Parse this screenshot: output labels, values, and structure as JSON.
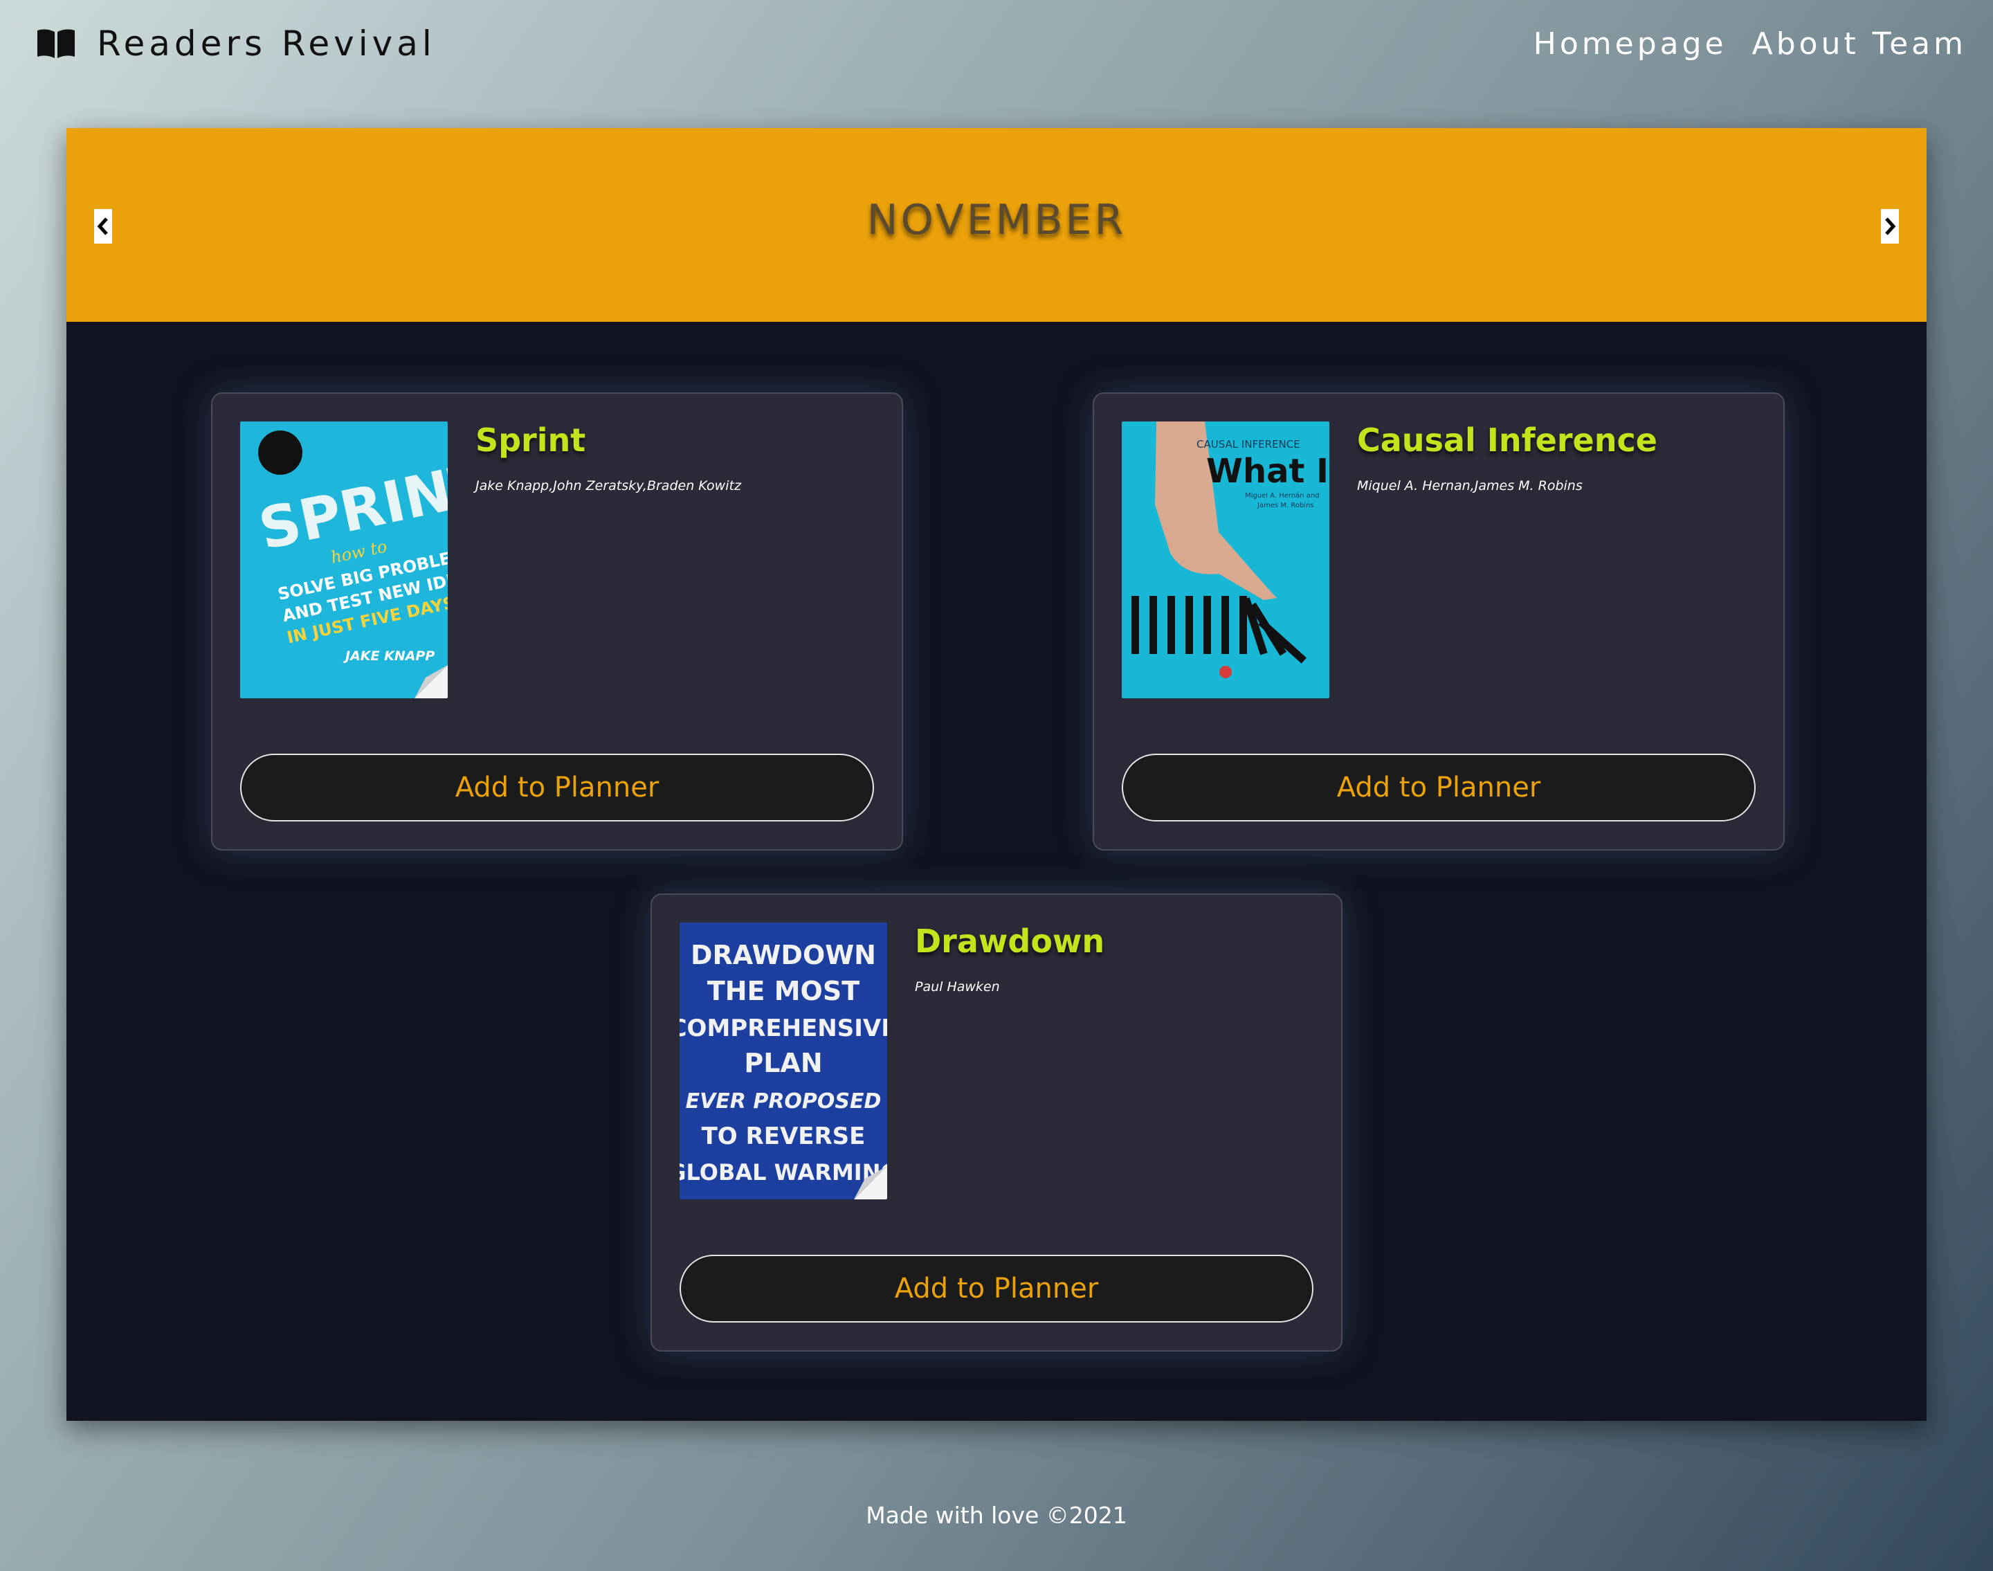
{
  "header": {
    "brand_icon": "open-book-icon",
    "brand_name": "Readers Revival",
    "nav": [
      {
        "label": "Homepage"
      },
      {
        "label": "About Team"
      }
    ]
  },
  "carousel": {
    "month": "NOVEMBER",
    "prev_icon": "chevron-left-icon",
    "next_icon": "chevron-right-icon",
    "accent_color": "#eba10a"
  },
  "books": [
    {
      "title": "Sprint",
      "authors": "Jake Knapp,John Zeratsky,Braden Kowitz",
      "button_label": "Add to Planner",
      "cover": {
        "background": "#1fb6dc",
        "lines": [
          "SPRINT",
          "how to",
          "SOLVE BIG PROBLEMS",
          "AND TEST NEW IDEAS",
          "IN JUST FIVE DAYS",
          "JAKE KNAPP"
        ]
      }
    },
    {
      "title": "Causal Inference",
      "authors": "Miquel A. Hernan,James M. Robins",
      "button_label": "Add to Planner",
      "cover": {
        "background": "#19b7d6",
        "lines": [
          "CAUSAL INFERENCE",
          "What If",
          "Miguel A. Hernán and",
          "James M. Robins"
        ]
      }
    },
    {
      "title": "Drawdown",
      "authors": "Paul Hawken",
      "button_label": "Add to Planner",
      "cover": {
        "background": "#1c3fa0",
        "lines": [
          "DRAWDOWN",
          "THE MOST",
          "COMPREHENSIVE",
          "PLAN",
          "EVER PROPOSED",
          "TO REVERSE",
          "GLOBAL WARMING"
        ]
      }
    }
  ],
  "footer": {
    "text": "Made with love ©2021"
  },
  "colors": {
    "title_green": "#c4e31c",
    "panel_dark": "#121320",
    "card_bg": "#2b2a38"
  }
}
